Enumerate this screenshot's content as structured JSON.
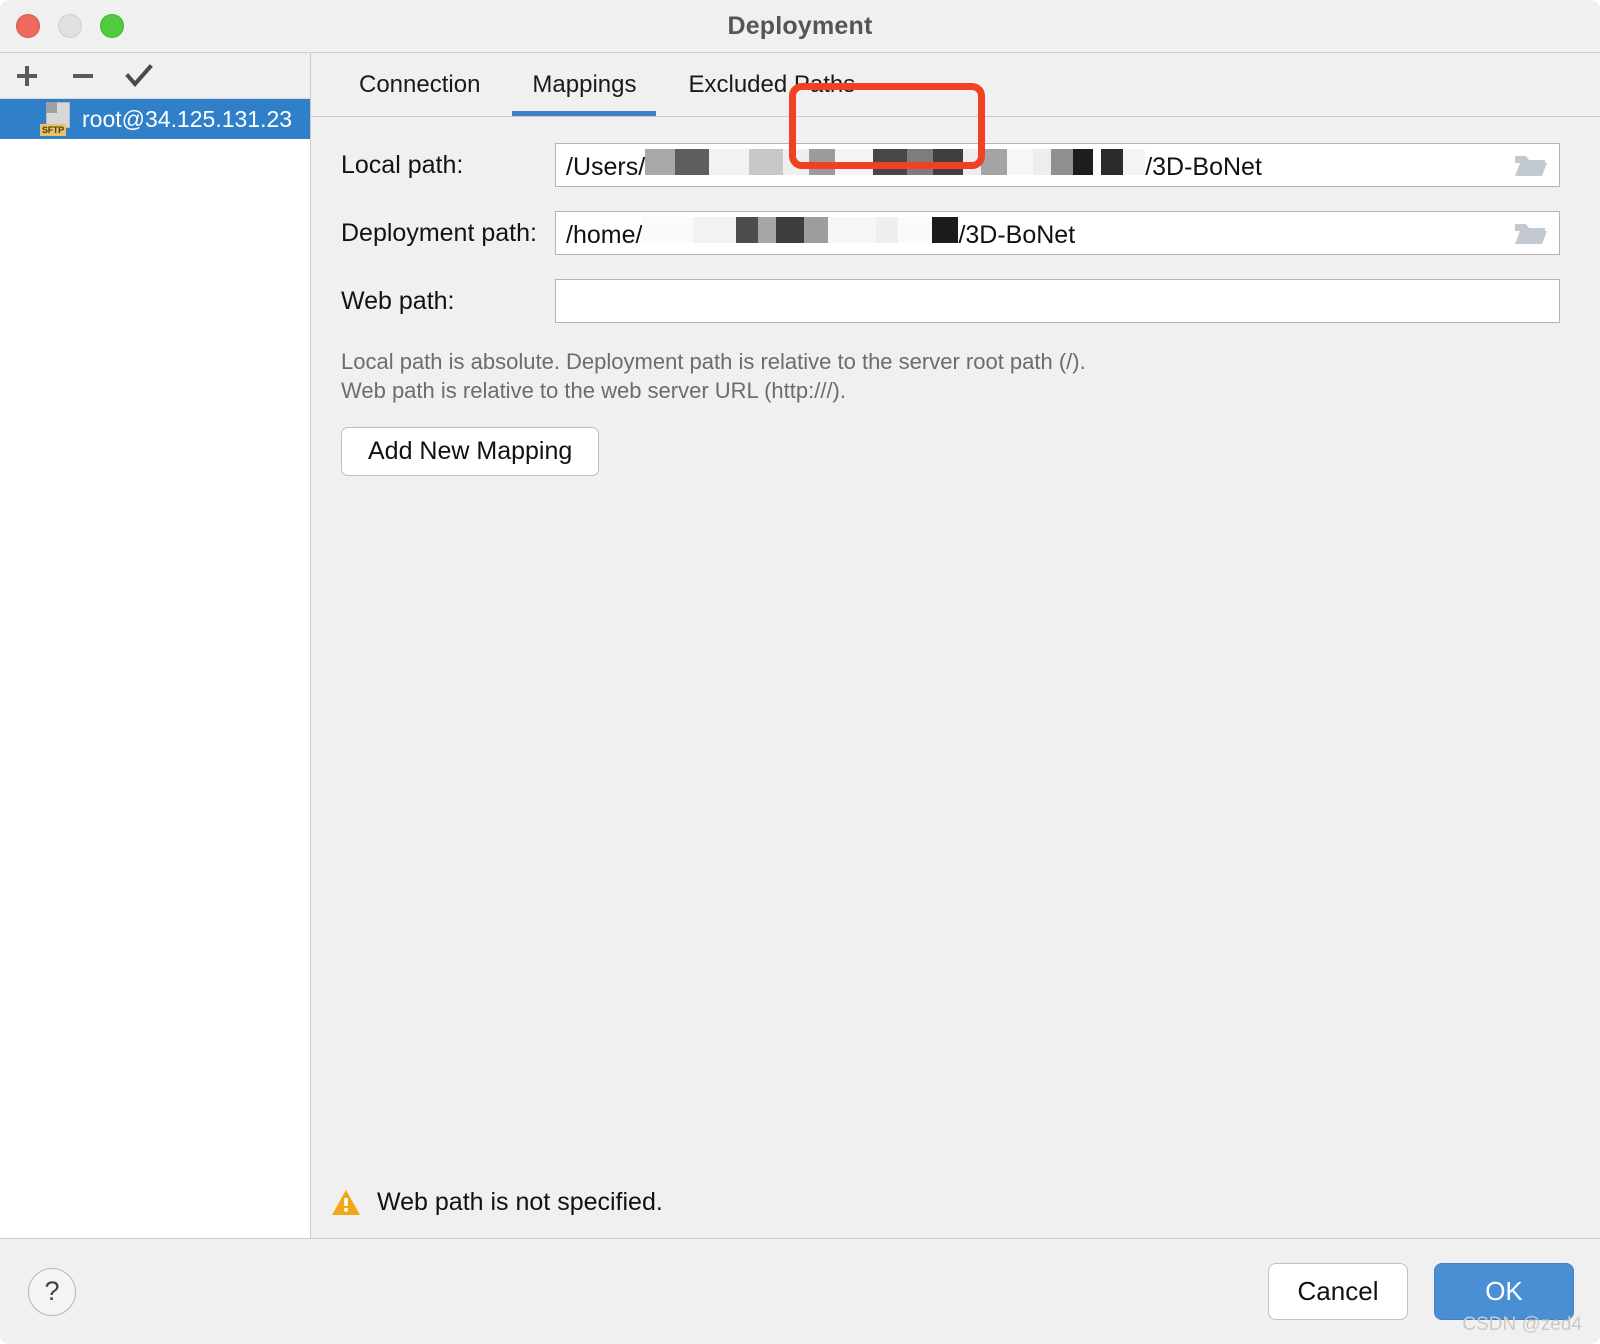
{
  "window": {
    "title": "Deployment",
    "traffic_lights": [
      "close-button",
      "minimize-button",
      "zoom-button"
    ]
  },
  "sidebar": {
    "toolbar": [
      {
        "name": "add-server-button",
        "glyph": "+"
      },
      {
        "name": "remove-server-button",
        "glyph": "−"
      },
      {
        "name": "set-default-server-button",
        "glyph": "✓"
      }
    ],
    "servers": [
      {
        "label": "root@34.125.131.23",
        "protocol_badge": "SFTP",
        "selected": true
      }
    ]
  },
  "tabs": [
    {
      "label": "Connection",
      "active": false
    },
    {
      "label": "Mappings",
      "active": true
    },
    {
      "label": "Excluded Paths",
      "active": false
    }
  ],
  "form": {
    "local_path": {
      "label": "Local path:",
      "prefix": "/Users/",
      "suffix": "/3D-BoNet",
      "value": "/Users/████████/3D-BoNet",
      "placeholder": "",
      "browse_icon": "folder-icon"
    },
    "deployment_path": {
      "label": "Deployment path:",
      "prefix": "/home/",
      "suffix": "/3D-BoNet",
      "value": "/home/████████/3D-BoNet",
      "placeholder": "",
      "browse_icon": "folder-icon"
    },
    "web_path": {
      "label": "Web path:",
      "value": "",
      "placeholder": ""
    },
    "hint_line_1": "Local path is absolute. Deployment path is relative to the server root path (/).",
    "hint_line_2": "Web path is relative to the web server URL (http:///).",
    "add_mapping_label": "Add New Mapping"
  },
  "warning": {
    "icon": "warning-triangle-icon",
    "text": "Web path is not specified."
  },
  "footer": {
    "help_label": "?",
    "cancel_label": "Cancel",
    "ok_label": "OK"
  },
  "watermark": "CSDN @zed4",
  "colors": {
    "accent_blue": "#3f7fc8",
    "primary_button": "#4a8fd4",
    "selection_blue": "#2f7fc9",
    "annotation_red": "#f04123",
    "warning_amber": "#f0a818",
    "sftp_badge": "#e8c168"
  }
}
